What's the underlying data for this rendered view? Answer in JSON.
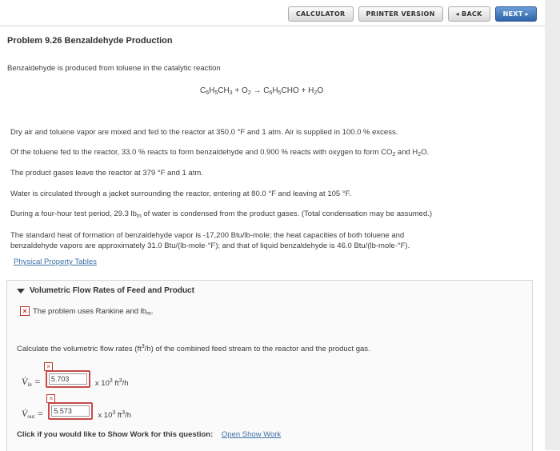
{
  "toolbar": {
    "calculator": "CALCULATOR",
    "printer": "PRINTER VERSION",
    "back": "◂ BACK",
    "next": "NEXT ▸"
  },
  "problem": {
    "title": "Problem 9.26 Benzaldehyde Production",
    "intro": "Benzaldehyde is produced from toluene in the catalytic reaction",
    "lines": [
      "Dry air and toluene vapor are mixed and fed to the reactor at 350.0 °F and 1 atm. Air is supplied in 100.0 % excess.",
      "The product gases leave the reactor at 379 °F and 1 atm.",
      "Water is circulated through a jacket surrounding the reactor, entering at 80.0 °F and leaving at 105 °F."
    ],
    "line_toluene_a": "Of the toluene fed to the reactor, 33.0 % reacts to form benzaldehyde and 0.900 % reacts with oxygen to form CO",
    "line_toluene_b": " and H",
    "line_toluene_c": "O.",
    "line_water_a": "During a four-hour test period, 29.3 lb",
    "line_water_b": "m",
    "line_water_c": " of water is condensed from the product gases. (Total condensation may be assumed.)",
    "line_heat_1": "The standard heat of formation of benzaldehyde vapor is -17,200 Btu/lb-mole; the heat capacities of both toluene and",
    "line_heat_2": "benzaldehyde vapors are approximately 31.0 Btu/(lb-mole·°F); and that of liquid benzaldehyde is 46.0 Btu/(lb-mole·°F).",
    "tables_link": "Physical Property Tables"
  },
  "section": {
    "title": "Volumetric Flow Rates of Feed and Product",
    "note_a": "The problem uses Rankine and lb",
    "note_b": "m",
    "note_c": ".",
    "calc_a": "Calculate the volumetric flow rates (ft",
    "calc_b": "3",
    "calc_c": "/h) of the combined feed stream to the reactor and the product gas.",
    "vin_value": "5.703",
    "vout_value": "5.573",
    "unit_a": "x 10",
    "unit_b": "3",
    "unit_c": " ft",
    "unit_d": "3",
    "unit_e": "/h",
    "show_work_prompt": "Click if you would like to Show Work for this question:",
    "show_work_link": "Open Show Work"
  },
  "colors": {
    "accent": "#3b6ea8",
    "error": "#c84a4a",
    "next_button": "#2f64a8"
  }
}
